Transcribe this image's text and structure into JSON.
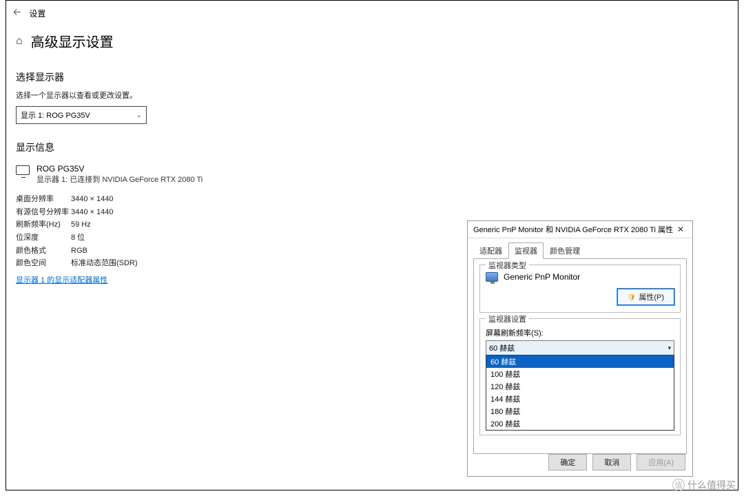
{
  "topbar": {
    "title": "设置"
  },
  "page": {
    "title": "高级显示设置"
  },
  "select_display": {
    "heading": "选择显示器",
    "hint": "选择一个显示器以查看或更改设置。",
    "value": "显示 1: ROG PG35V"
  },
  "display_info": {
    "heading": "显示信息",
    "monitor_name": "ROG PG35V",
    "monitor_desc": "显示器 1: 已连接到 NVIDIA GeForce RTX 2080 Ti",
    "rows": [
      {
        "k": "桌面分辨率",
        "v": "3440 × 1440"
      },
      {
        "k": "有源信号分辨率",
        "v": "3440 × 1440"
      },
      {
        "k": "刷新频率(Hz)",
        "v": "59 Hz"
      },
      {
        "k": "位深度",
        "v": "8 位"
      },
      {
        "k": "颜色格式",
        "v": "RGB"
      },
      {
        "k": "颜色空间",
        "v": "标准动态范围(SDR)"
      }
    ],
    "adapter_link": "显示器 1 的显示适配器属性"
  },
  "dialog": {
    "title": "Generic PnP Monitor 和 NVIDIA GeForce RTX 2080 Ti 属性",
    "tabs": [
      "适配器",
      "监视器",
      "颜色管理"
    ],
    "active_tab": "监视器",
    "monitor_type_group": "监视器类型",
    "monitor_name": "Generic PnP Monitor",
    "properties_btn": "属性(P)",
    "monitor_settings_group": "监视器设置",
    "refresh_label": "屏幕刷新频率(S):",
    "refresh_selected": "60 赫兹",
    "refresh_options": [
      "60 赫兹",
      "100 赫兹",
      "120 赫兹",
      "144 赫兹",
      "180 赫兹",
      "200 赫兹"
    ],
    "buttons": {
      "ok": "确定",
      "cancel": "取消",
      "apply": "应用(A)"
    }
  },
  "watermark": {
    "badge": "值",
    "text": "什么值得买"
  }
}
